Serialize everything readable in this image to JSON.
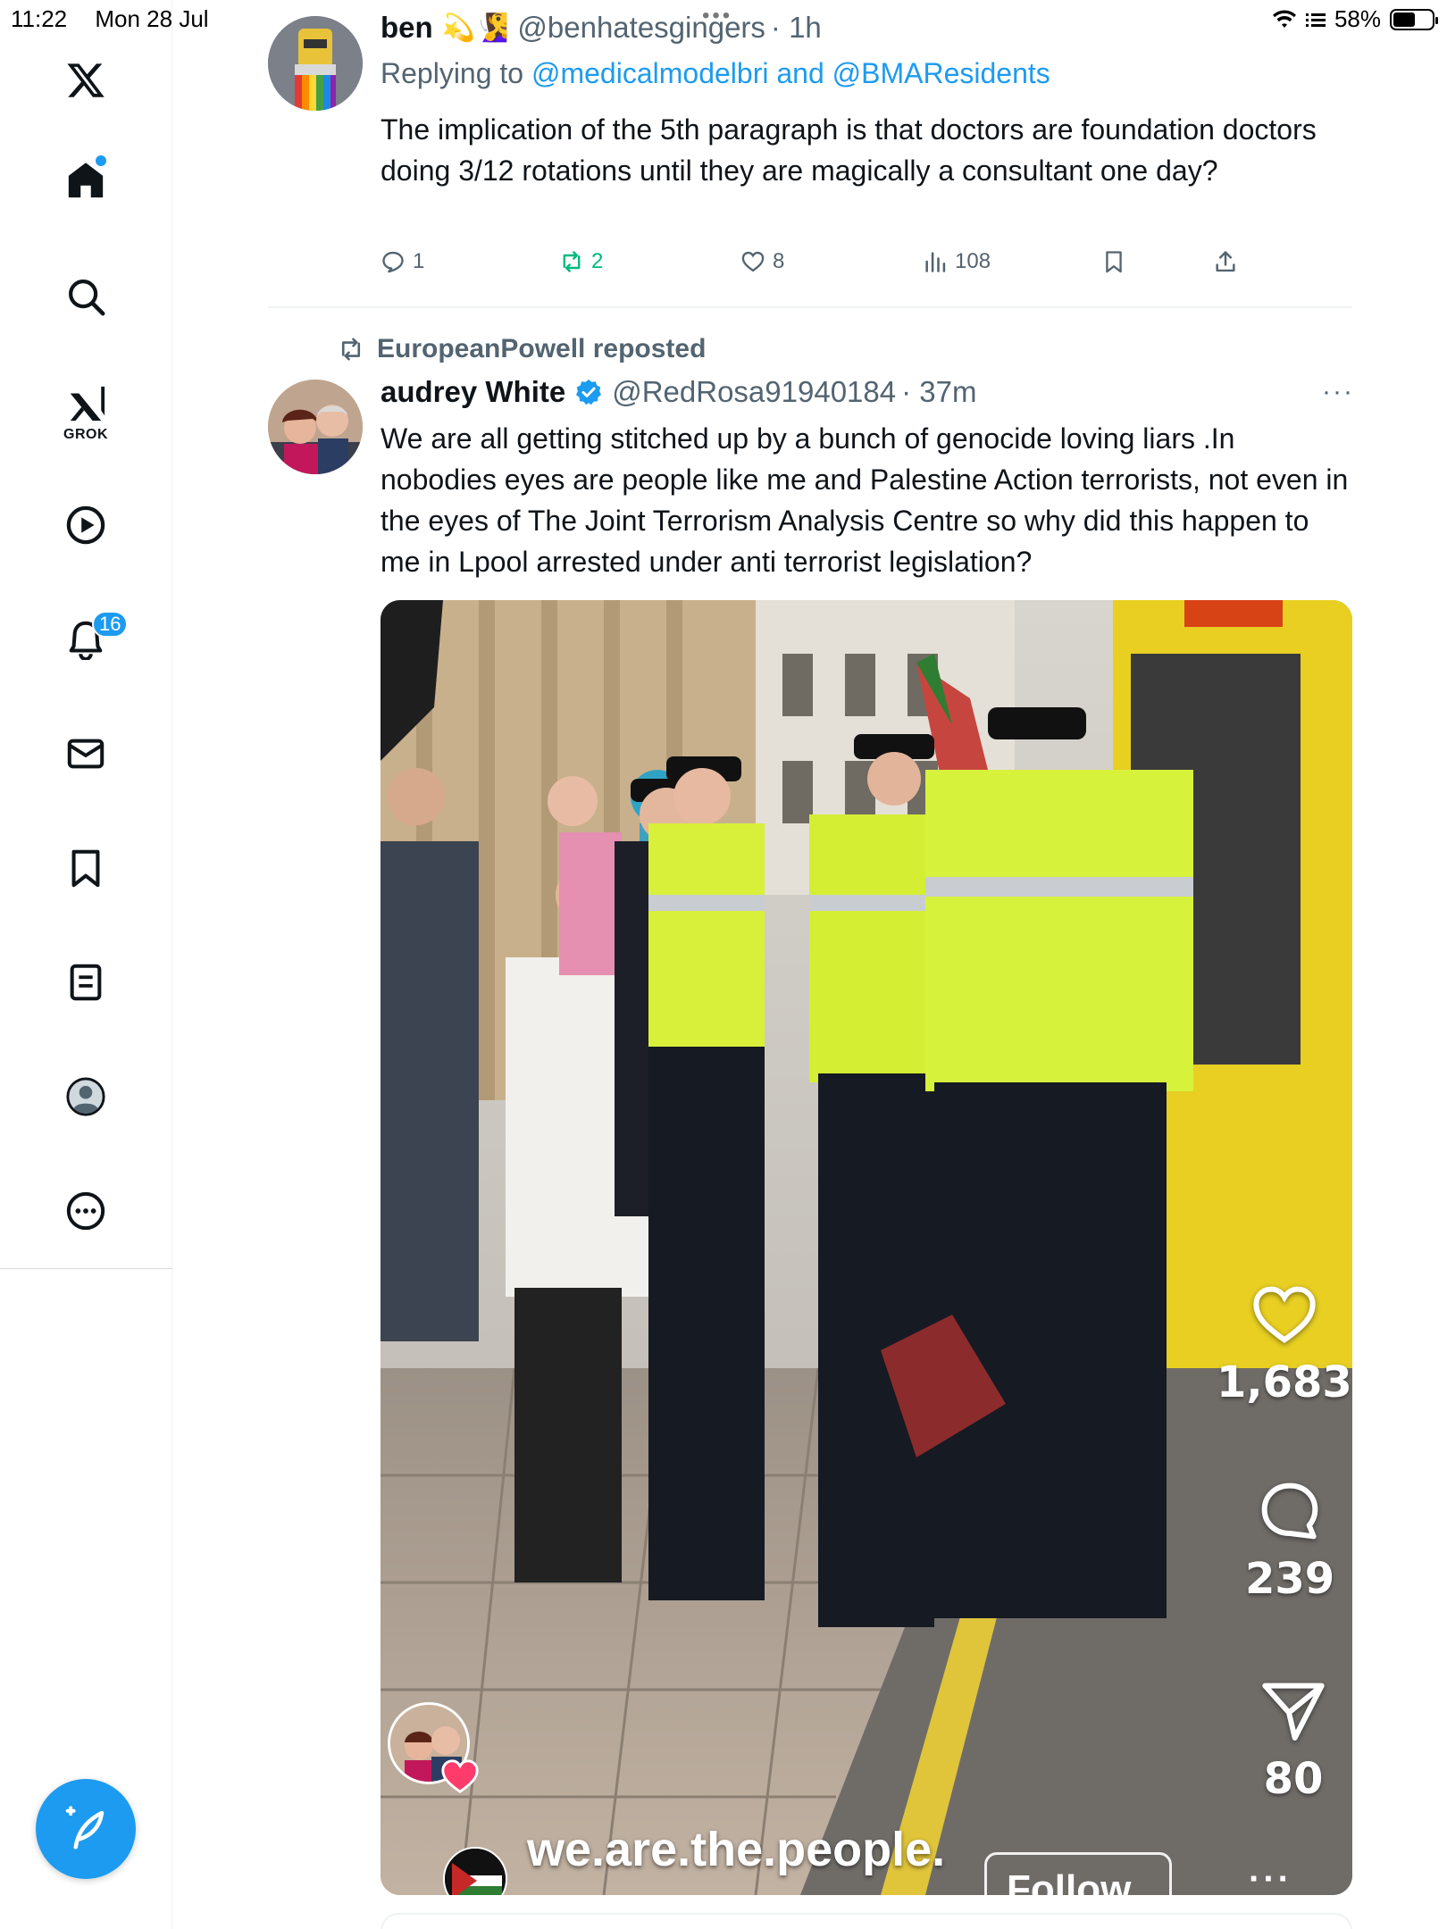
{
  "status_bar": {
    "time": "11:22",
    "date": "Mon 28 Jul",
    "battery": "58%",
    "battery_level": 0.58
  },
  "sidebar": {
    "items": [
      {
        "name": "x-logo",
        "icon": "x-logo-icon"
      },
      {
        "name": "home",
        "icon": "home-icon",
        "has_dot": true
      },
      {
        "name": "explore",
        "icon": "search-icon"
      },
      {
        "name": "grok",
        "icon": "grok-icon",
        "label": "GROK"
      },
      {
        "name": "videos",
        "icon": "play-icon"
      },
      {
        "name": "notifications",
        "icon": "bell-icon",
        "badge": "16"
      },
      {
        "name": "messages",
        "icon": "mail-icon"
      },
      {
        "name": "bookmarks",
        "icon": "bookmark-icon"
      },
      {
        "name": "lists",
        "icon": "list-icon"
      },
      {
        "name": "profile",
        "icon": "profile-icon"
      },
      {
        "name": "more",
        "icon": "more-icon"
      }
    ],
    "compose_icon": "compose-icon"
  },
  "tweet1": {
    "display_name": "ben",
    "emojis": "💫🧏‍♀️",
    "handle": "@benhatesgingers",
    "time": "· 1h",
    "replying_label": "Replying to",
    "reply_handle_1": "@medicalmodelbri",
    "reply_and": "and",
    "reply_handle_2": "@BMAResidents",
    "text": "The implication of the 5th paragraph is that doctors are foundation doctors doing 3/12 rotations until they are magically a consultant one day?",
    "stats": {
      "replies": "1",
      "reposts": "2",
      "likes": "8",
      "views": "108"
    }
  },
  "tweet2": {
    "repost_by": "EuropeanPowell reposted",
    "display_name": "audrey White",
    "verified": true,
    "handle": "@RedRosa91940184",
    "time": "· 37m",
    "text": "We are all getting stitched up by a bunch of genocide loving liars .In nobodies eyes are people like me and Palestine Action terrorists, not even in the eyes of The Joint Terrorism Analysis Centre so why did this happen to me in Lpool arrested under anti terrorist legislation?",
    "video": {
      "likes": "1,683",
      "comments": "239",
      "shares": "80",
      "watermark": "we.are.the.people.",
      "follow_label": "Follow"
    }
  },
  "colors": {
    "accent": "#1d9bf0",
    "repost_green": "#00ba7c",
    "secondary_text": "#536471"
  }
}
